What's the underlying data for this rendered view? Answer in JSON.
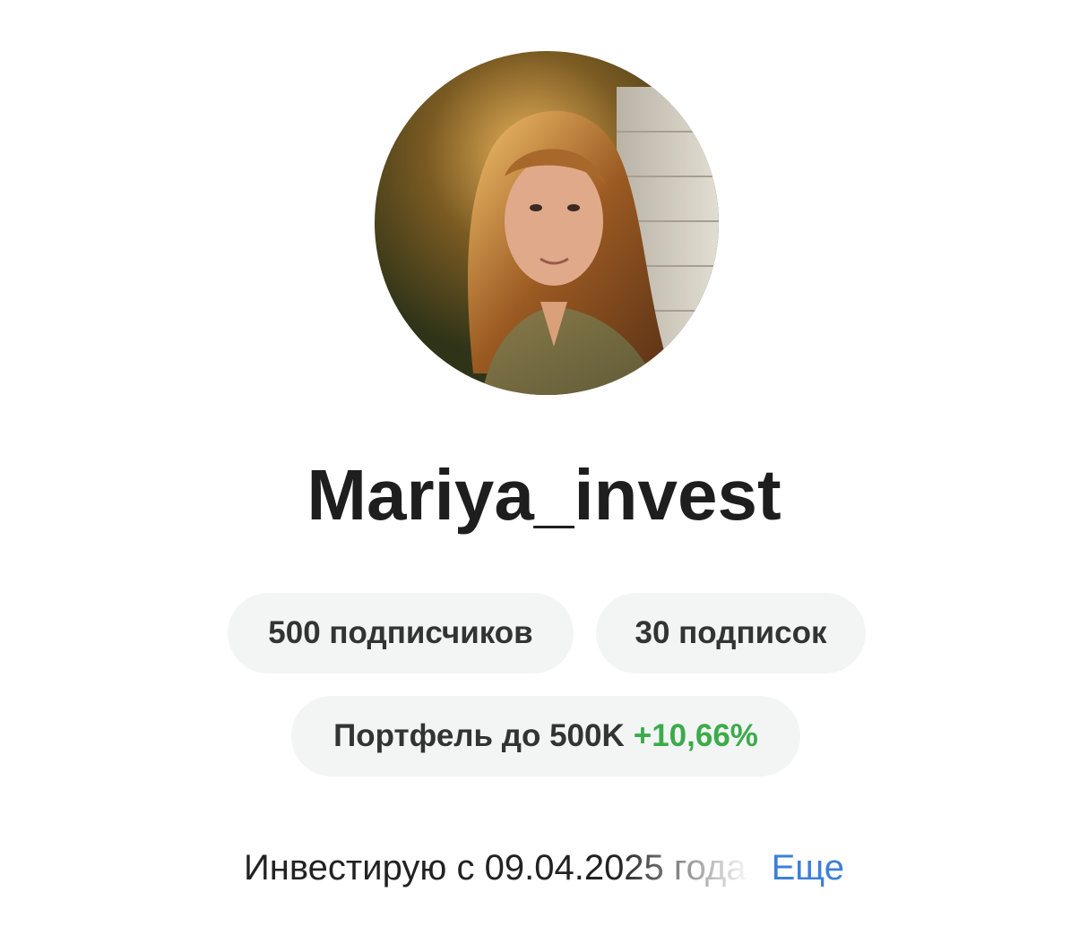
{
  "profile": {
    "username": "Mariya_invest",
    "avatar_alt": "profile-photo"
  },
  "stats": {
    "followers": "500 подписчиков",
    "following": "30 подписок"
  },
  "portfolio": {
    "label": "Портфель до 500K",
    "gain": "+10,66%",
    "gain_color": "#3cab4a"
  },
  "bio": {
    "text": "Инвестирую с 09.04.2025 года",
    "more_label": "Еще",
    "more_color": "#3c7fd9"
  }
}
